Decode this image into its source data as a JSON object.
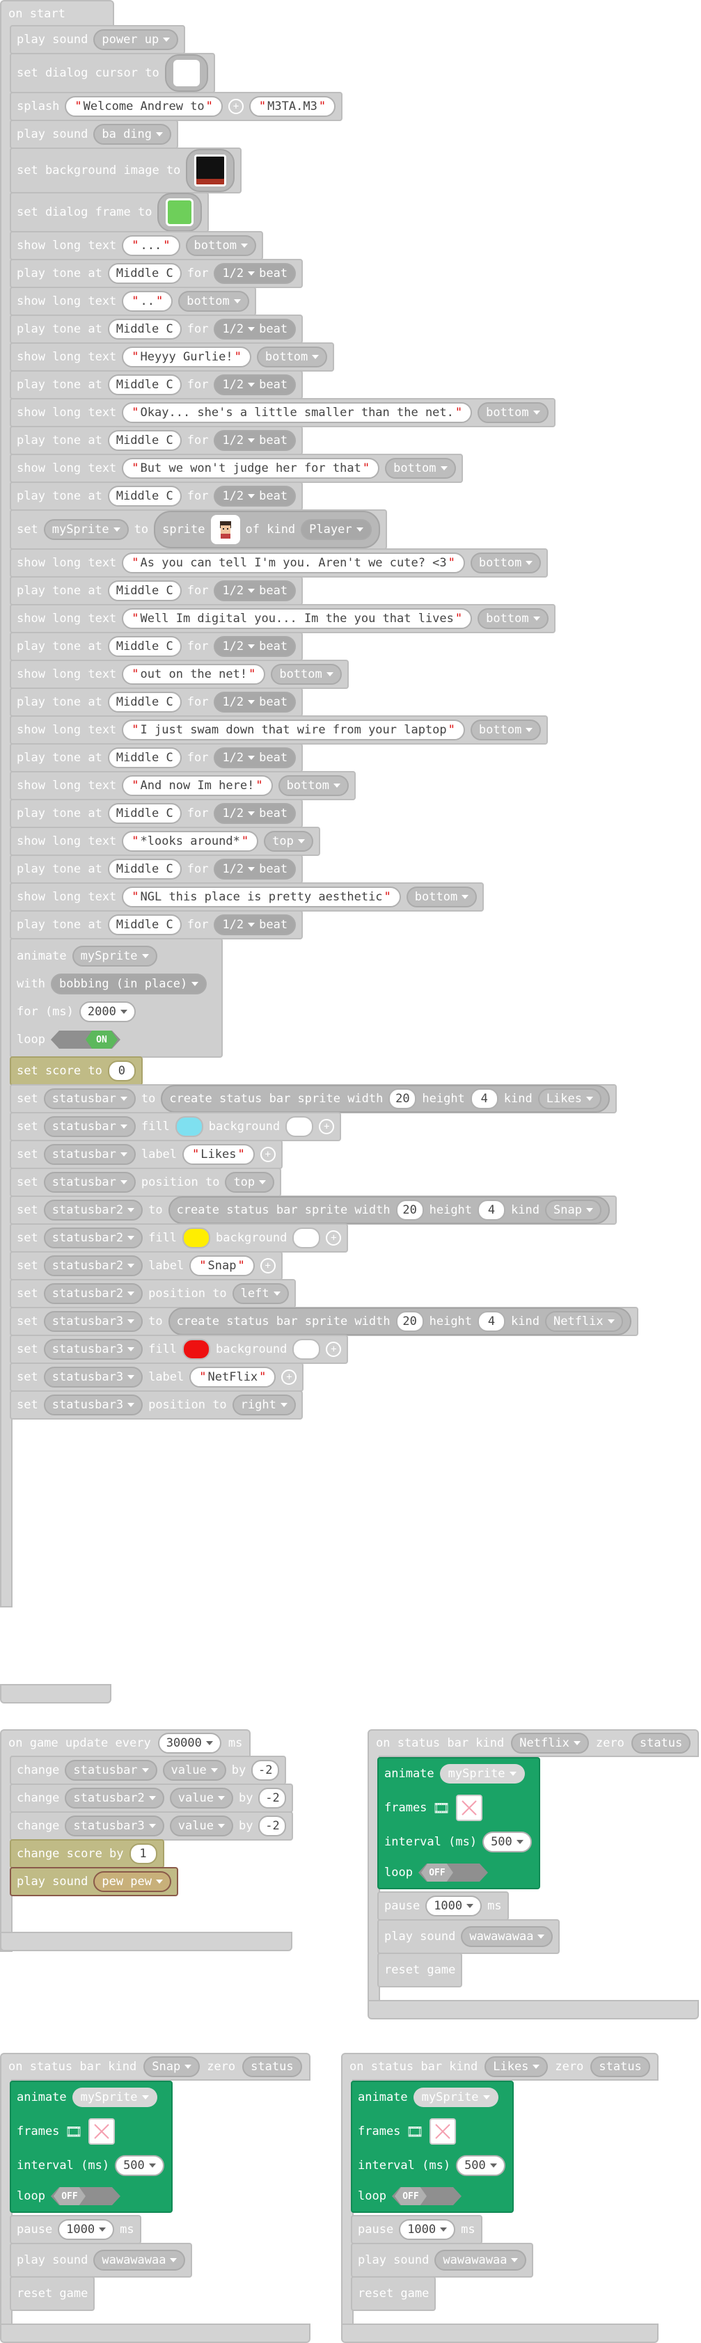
{
  "on_start": {
    "title": "on start",
    "play_sound_1": {
      "label": "play sound",
      "value": "power up"
    },
    "dialog_cursor": {
      "label": "set dialog cursor to"
    },
    "splash": {
      "label": "splash",
      "text1": "Welcome Andrew to",
      "text2": "M3TA.M3"
    },
    "play_sound_2": {
      "label": "play sound",
      "value": "ba ding"
    },
    "background": {
      "label": "set background image to"
    },
    "dialog_frame": {
      "label": "set dialog frame to"
    },
    "dialogue": [
      {
        "type": "text",
        "text": "...",
        "pos": "bottom"
      },
      {
        "type": "tone"
      },
      {
        "type": "text",
        "text": "..",
        "pos": "bottom"
      },
      {
        "type": "tone"
      },
      {
        "type": "text",
        "text": "Heyyy Gurlie!",
        "pos": "bottom"
      },
      {
        "type": "tone"
      },
      {
        "type": "text",
        "text": "Okay... she's a little smaller than the net.",
        "pos": "bottom"
      },
      {
        "type": "tone"
      },
      {
        "type": "text",
        "text": "But we won't judge her for that",
        "pos": "bottom"
      },
      {
        "type": "tone"
      }
    ],
    "show_long_text_label": "show long text",
    "tone": {
      "label": "play tone at",
      "note": "Middle C",
      "for": "for",
      "beat": "1/2",
      "beat_label": "beat"
    },
    "set_sprite": {
      "set": "set",
      "var": "mySprite",
      "to": "to",
      "sprite": "sprite",
      "of_kind": "of kind",
      "kind": "Player"
    },
    "dialogue2": [
      {
        "type": "text",
        "text": "As you can tell I'm you. Aren't we cute? <3",
        "pos": "bottom"
      },
      {
        "type": "tone"
      },
      {
        "type": "text",
        "text": "Well Im digital you... Im the you that lives",
        "pos": "bottom"
      },
      {
        "type": "tone"
      },
      {
        "type": "text",
        "text": "out on the net! ",
        "pos": "bottom"
      },
      {
        "type": "tone"
      },
      {
        "type": "text",
        "text": "I just swam down that wire from your laptop",
        "pos": "bottom"
      },
      {
        "type": "tone"
      },
      {
        "type": "text",
        "text": "And now Im here!",
        "pos": "bottom"
      },
      {
        "type": "tone"
      },
      {
        "type": "text",
        "text": "*looks around*",
        "pos": "top"
      },
      {
        "type": "tone"
      },
      {
        "type": "text",
        "text": "NGL this place is pretty aesthetic",
        "pos": "bottom"
      },
      {
        "type": "tone"
      }
    ],
    "animate": {
      "label": "animate",
      "sprite": "mySprite",
      "with": "with",
      "anim": "bobbing (in place)",
      "for_ms": "for (ms)",
      "ms": "2000",
      "loop": "loop",
      "loop_state": "ON"
    },
    "score": {
      "label": "set score to",
      "value": "0"
    },
    "statusbars": [
      {
        "var": "statusbar",
        "width": "20",
        "height": "4",
        "kind": "Likes",
        "fill": "#7fe0f0",
        "label": "Likes",
        "position": "top"
      },
      {
        "var": "statusbar2",
        "width": "20",
        "height": "4",
        "kind": "Snap",
        "fill": "#ffee00",
        "label": "Snap",
        "position": "left"
      },
      {
        "var": "statusbar3",
        "width": "20",
        "height": "4",
        "kind": "Netflix",
        "fill": "#ee1111",
        "label": "NetFlix",
        "position": "right"
      }
    ],
    "sb_labels": {
      "set": "set",
      "to": "to",
      "create": "create status bar sprite width",
      "height": "height",
      "kind": "kind",
      "fill": "fill",
      "background": "background",
      "label": "label",
      "position_to": "position to"
    }
  },
  "game_update": {
    "title": "on game update every",
    "interval": "30000",
    "ms": "ms",
    "changes": [
      {
        "var": "statusbar",
        "value": "value",
        "by": "by",
        "amount": "-2"
      },
      {
        "var": "statusbar2",
        "value": "value",
        "by": "by",
        "amount": "-2"
      },
      {
        "var": "statusbar3",
        "value": "value",
        "by": "by",
        "amount": "-2"
      }
    ],
    "change_label": "change",
    "change_score": {
      "label": "change score by",
      "value": "1"
    },
    "play_sound": {
      "label": "play sound",
      "value": "pew pew"
    }
  },
  "zero_handlers": [
    {
      "title": "on status bar kind",
      "kind": "Netflix",
      "zero": "zero",
      "status": "status"
    },
    {
      "title": "on status bar kind",
      "kind": "Snap",
      "zero": "zero",
      "status": "status"
    },
    {
      "title": "on status bar kind",
      "kind": "Likes",
      "zero": "zero",
      "status": "status"
    }
  ],
  "zero_body": {
    "animate": "animate",
    "sprite": "mySprite",
    "frames": "frames",
    "interval": "interval (ms)",
    "interval_value": "500",
    "loop": "loop",
    "loop_state": "OFF",
    "pause": "pause",
    "pause_value": "1000",
    "ms": "ms",
    "play_sound": "play sound",
    "sound": "wawawawaa",
    "reset": "reset game"
  }
}
